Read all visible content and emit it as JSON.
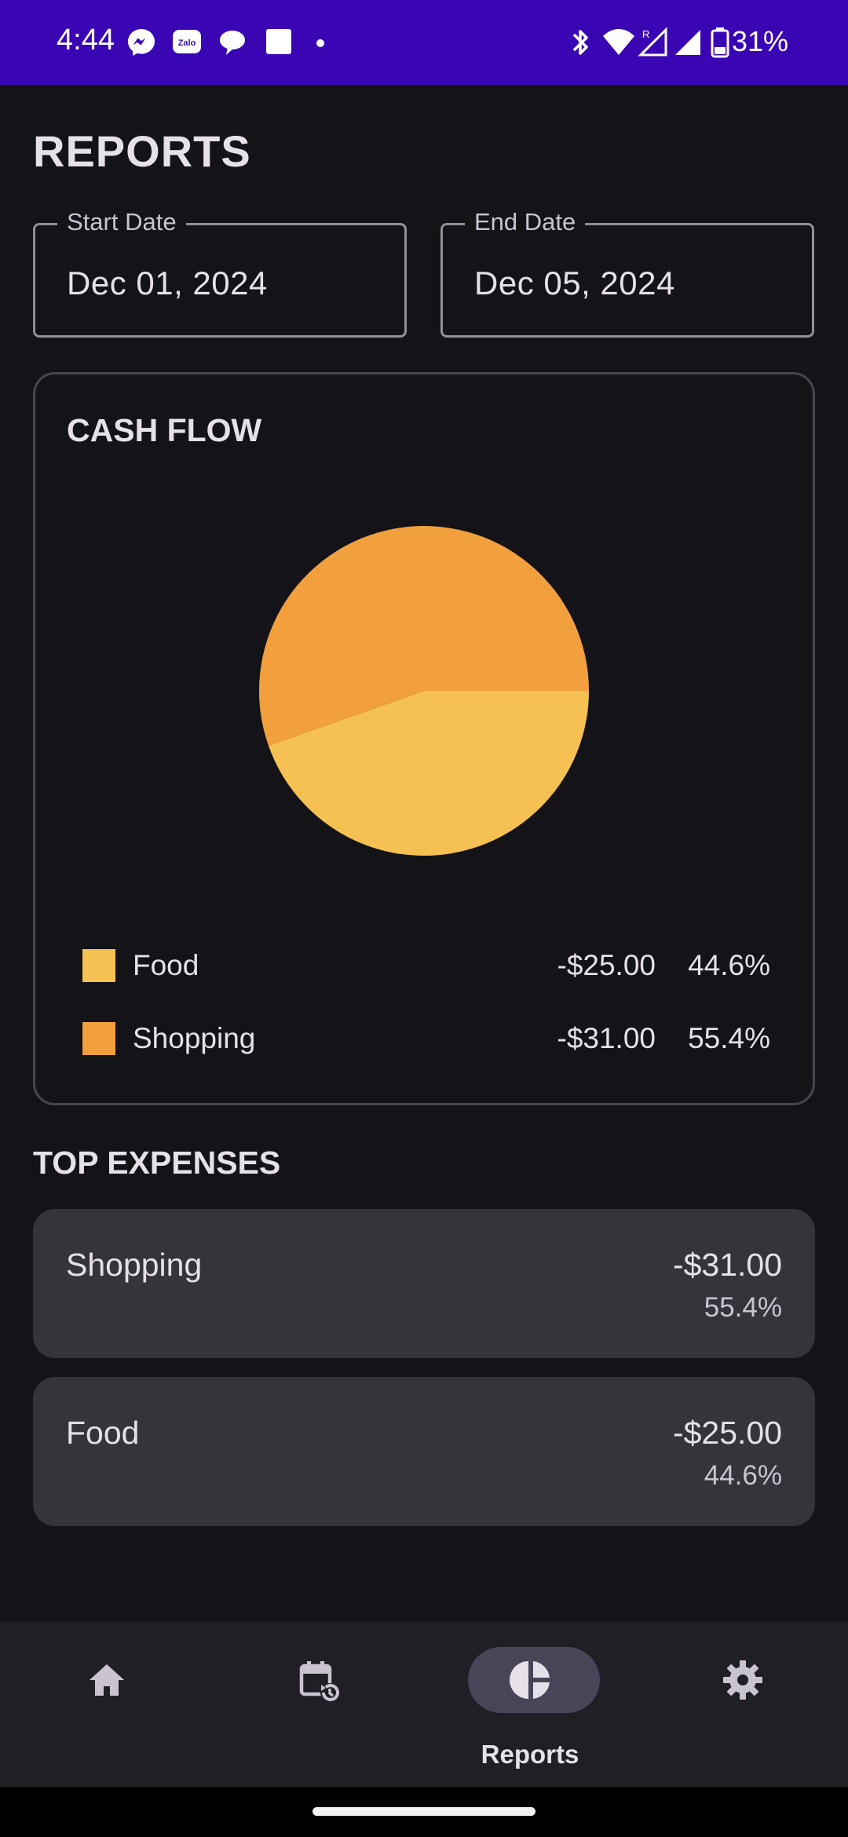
{
  "status_bar": {
    "time": "4:44",
    "battery": "31%",
    "background": "#3a06b4",
    "left_icons": [
      "messenger-icon",
      "zalo-icon",
      "chat-bubble-icon",
      "square-app-icon",
      "dot-icon"
    ],
    "right_icons": [
      "bluetooth-icon",
      "wifi-icon",
      "signal-roaming-icon",
      "signal-icon",
      "battery-icon"
    ],
    "zalo_text": "Zalo"
  },
  "page": {
    "title": "REPORTS"
  },
  "date_range": {
    "start_label": "Start Date",
    "start_value": "Dec 01, 2024",
    "end_label": "End Date",
    "end_value": "Dec 05, 2024"
  },
  "cash_flow": {
    "title": "CASH FLOW",
    "legend": [
      {
        "name": "Food",
        "amount": "-$25.00",
        "percent": "44.6%",
        "color": "#f4c152"
      },
      {
        "name": "Shopping",
        "amount": "-$31.00",
        "percent": "55.4%",
        "color": "#f2a03d"
      }
    ]
  },
  "chart_data": {
    "type": "pie",
    "title": "CASH FLOW",
    "categories": [
      "Food",
      "Shopping"
    ],
    "values": [
      44.6,
      55.4
    ],
    "amounts": [
      -25.0,
      -31.0
    ],
    "colors": [
      "#f4c152",
      "#f2a03d"
    ],
    "legend": "bottom"
  },
  "top_expenses": {
    "title": "TOP EXPENSES",
    "items": [
      {
        "name": "Shopping",
        "amount": "-$31.00",
        "percent": "55.4%"
      },
      {
        "name": "Food",
        "amount": "-$25.00",
        "percent": "44.6%"
      }
    ]
  },
  "bottom_nav": {
    "items": [
      {
        "icon": "home-icon",
        "label": ""
      },
      {
        "icon": "calendar-history-icon",
        "label": ""
      },
      {
        "icon": "reports-pie-icon",
        "label": "Reports",
        "active": true
      },
      {
        "icon": "settings-gear-icon",
        "label": ""
      }
    ],
    "active_indicator_color": "#4a4458"
  }
}
